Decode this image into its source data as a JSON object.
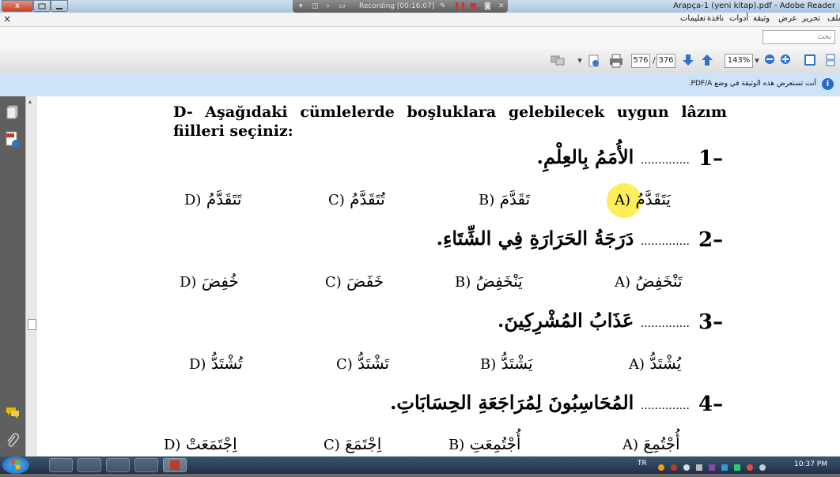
{
  "window": {
    "title": "Arapça-1 (yeni kitap).pdf - Adobe Reader",
    "close_label": "x"
  },
  "recorder": {
    "status": "Recording [00:16:07]"
  },
  "menubar": {
    "close_glyph": "×",
    "items": [
      "ملف",
      "تحرير",
      "عرض",
      "وثيقة",
      "أدوات",
      "نافذة",
      "تعليمات"
    ]
  },
  "search": {
    "placeholder": "بحث"
  },
  "toolbar": {
    "current_page": "576",
    "separator": "/",
    "total_pages": "376",
    "zoom": "143%"
  },
  "infobar": {
    "message": "أنت تستعرض هذه الوثيقة في وضع PDF/A."
  },
  "document": {
    "heading": "D- Aşağıdaki cümlelerde boşluklara gelebilecek uygun lâzım fiilleri seçiniz:",
    "questions": [
      {
        "number": "1",
        "sentence": "الأُمَمُ بِالعِلْمِ.",
        "blank": "..............",
        "options": [
          {
            "letter": "A)",
            "text": "يَتَقَدَّمُ"
          },
          {
            "letter": "B)",
            "text": "تَقَدَّمَ"
          },
          {
            "letter": "C)",
            "text": "تُتَقَدَّمُ"
          },
          {
            "letter": "D)",
            "text": "تَتَقَدَّمُ"
          }
        ]
      },
      {
        "number": "2",
        "sentence": "دَرَجَةُ الحَرَارَةِ فِي الشِّتَاءِ.",
        "blank": "..............",
        "options": [
          {
            "letter": "A)",
            "text": "تَنْخَفِضُ"
          },
          {
            "letter": "B)",
            "text": "يَنْخَفِضُ"
          },
          {
            "letter": "C)",
            "text": "خَفَضَ"
          },
          {
            "letter": "D)",
            "text": "خُفِضَ"
          }
        ]
      },
      {
        "number": "3",
        "sentence": "عَذَابُ المُشْرِكِينَ.",
        "blank": "..............",
        "options": [
          {
            "letter": "A)",
            "text": "يُشْتَدُّ"
          },
          {
            "letter": "B)",
            "text": "يَشْتَدُّ"
          },
          {
            "letter": "C)",
            "text": "تَشْتَدُّ"
          },
          {
            "letter": "D)",
            "text": "تُشْتَدُّ"
          }
        ]
      },
      {
        "number": "4",
        "sentence": "المُحَاسِبُونَ لِمُرَاجَعَةِ الحِسَابَاتِ.",
        "blank": "..............",
        "options": [
          {
            "letter": "A)",
            "text": "أُجْتُمِعَ"
          },
          {
            "letter": "B)",
            "text": "أُجْتُمِعَتِ"
          },
          {
            "letter": "C)",
            "text": "اِجْتَمَعَ"
          },
          {
            "letter": "D)",
            "text": "اِجْتَمَعَتْ"
          }
        ]
      }
    ]
  },
  "taskbar": {
    "language": "TR",
    "clock": "10:37 PM"
  }
}
